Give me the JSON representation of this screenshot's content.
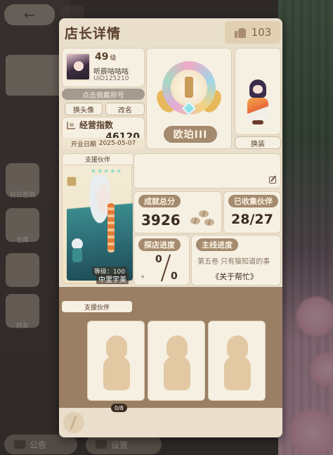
{
  "background": {
    "back_icon": "arrow-left-icon",
    "left_menu_labels": [
      "日日签到",
      "仓库",
      "好友"
    ],
    "bottom_bar": {
      "notice_label": "公告",
      "settings_label": "设置"
    }
  },
  "dialog": {
    "title": "店长详情",
    "likes_icon": "thumbs-up-icon",
    "likes_count": "103"
  },
  "owner": {
    "level": "49",
    "level_suffix": "级",
    "name": "听辰咕咕咕",
    "uid": "UID125210",
    "badge_button": "点击佩戴称号",
    "change_avatar_button": "换头像",
    "rename_button": "改名",
    "rating_label": "经营指数",
    "rating_value": "46120",
    "open_date_label": "开业日期",
    "open_date": "2025-05-07"
  },
  "rank": {
    "label": "欧珀III"
  },
  "outfit": {
    "change_button": "换装"
  },
  "partner": {
    "tag": "支援伙伴",
    "stars": "★★★★★",
    "level": "等级：100",
    "name": "中里宇美"
  },
  "stats": {
    "score_label": "成就总分",
    "score_value": "3926",
    "collected_label": "已收集伙伴",
    "collected_value": "28/27",
    "explore_label": "探店进度",
    "explore_current": "0",
    "explore_total": "0",
    "story_label": "主线进度",
    "story_chapter": "第五卷 只有猫知道的事",
    "story_title": "《关于帮忙》"
  },
  "support_section": {
    "tag": "支援伙伴"
  },
  "footer": {
    "badge_text": "0/8"
  },
  "colors": {
    "panel": "#e9dfcc",
    "card": "#f6f0e3",
    "accent_brown": "#a48a6e",
    "text_dark": "#3b2c20"
  }
}
